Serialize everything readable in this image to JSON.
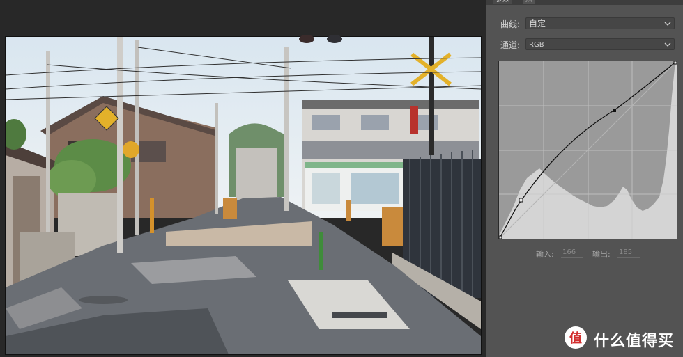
{
  "panel": {
    "tabs": [
      "参数",
      "点"
    ],
    "curve_label": "曲线:",
    "curve_value": "自定",
    "channel_label": "通道:",
    "channel_value": "RGB",
    "input_label": "输入:",
    "input_value": "166",
    "output_label": "输出:",
    "output_value": "185"
  },
  "watermark": {
    "text": "什么值得买",
    "logo_glyph": "值"
  },
  "icons": {
    "dropdown": "chevron-down-icon",
    "logo": "zhide-logo-icon"
  }
}
